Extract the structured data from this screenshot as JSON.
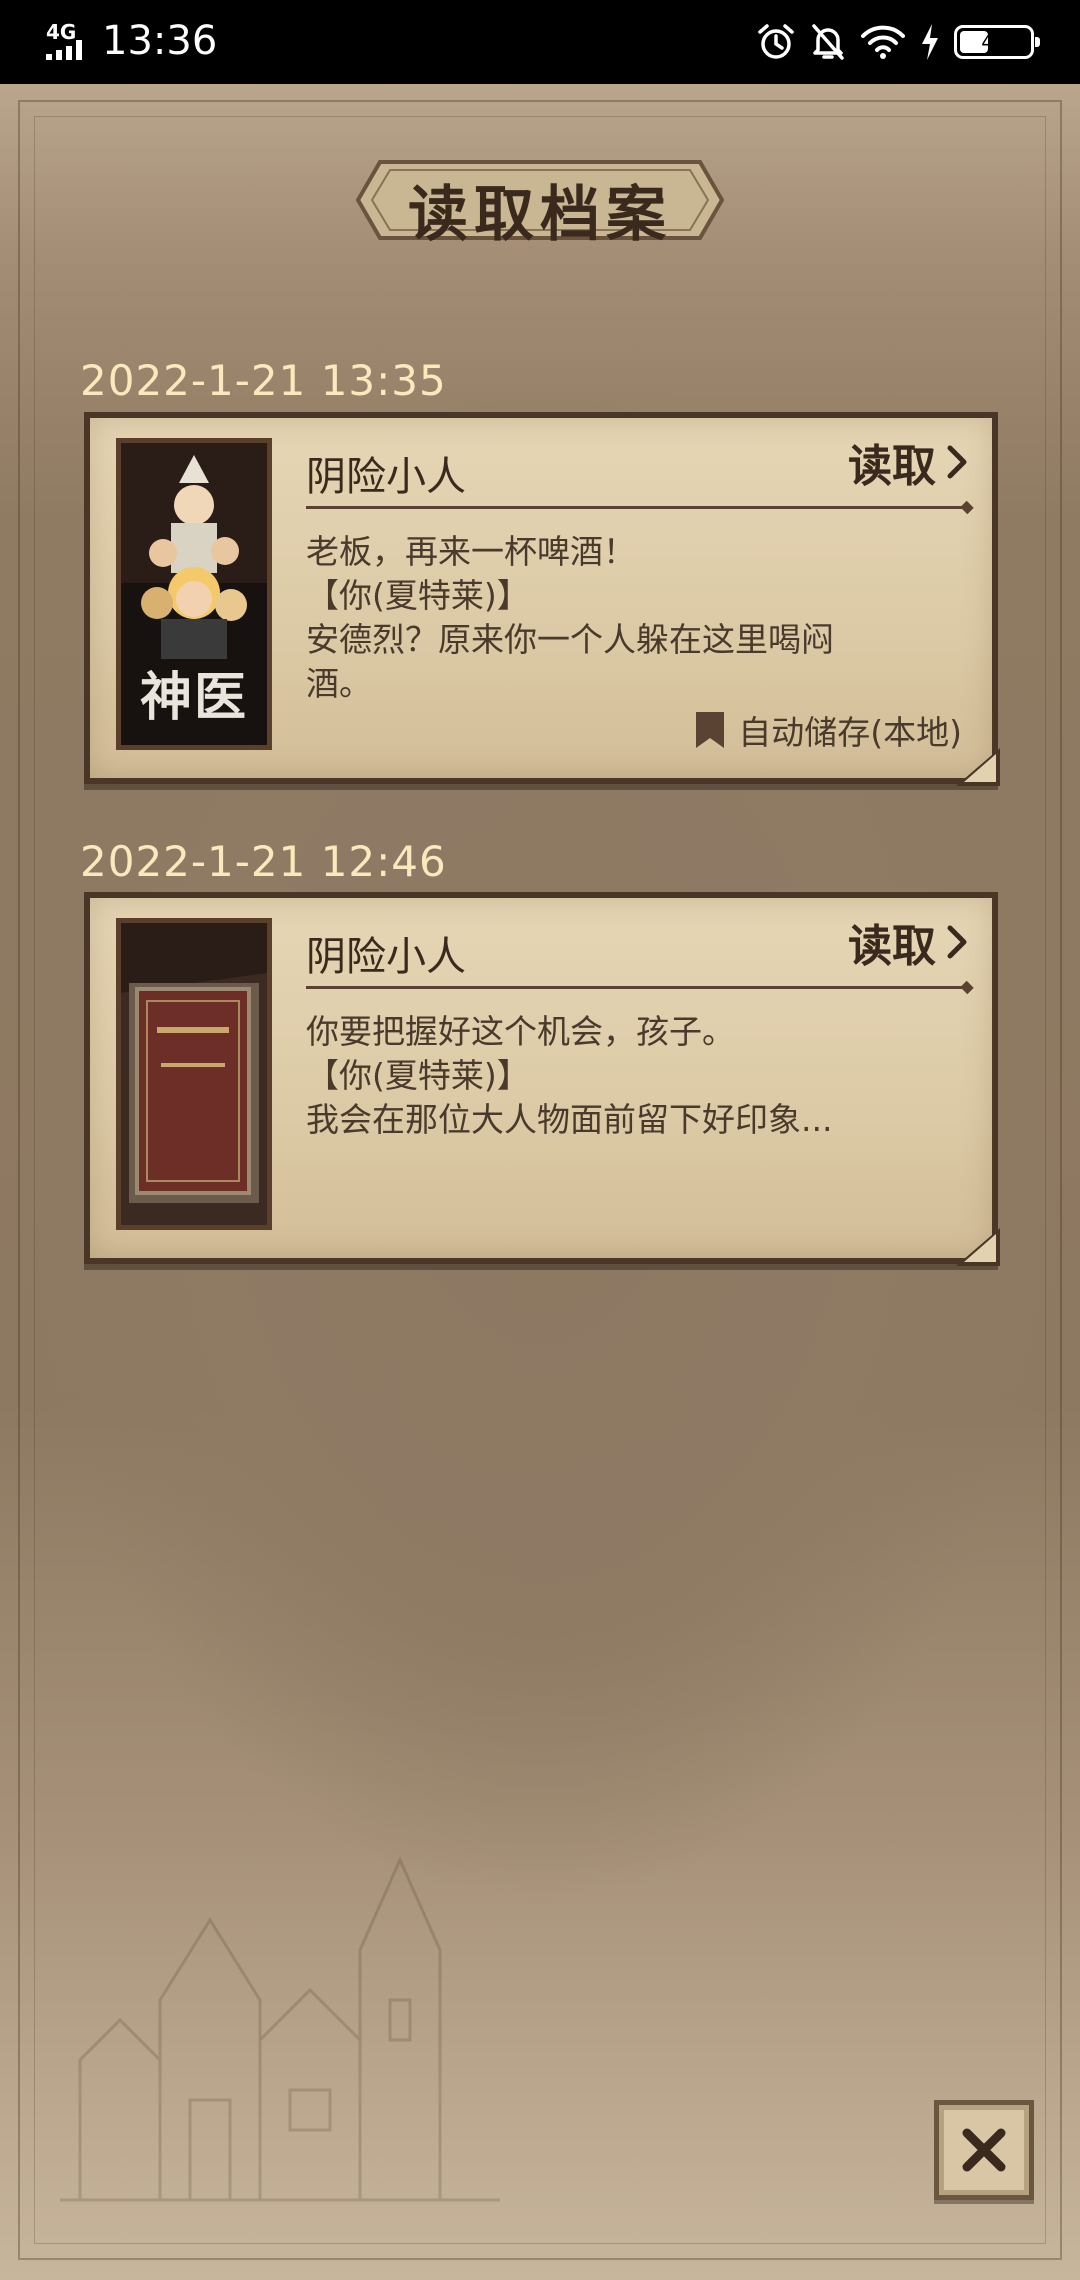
{
  "status_bar": {
    "network": "4G",
    "time": "13:36",
    "battery_level": "46"
  },
  "page": {
    "title": "读取档案"
  },
  "saves": [
    {
      "date": "2022-1-21  13:35",
      "title": "阴险小人",
      "read_label": "读取",
      "lines": [
        "老板，再来一杯啤酒！",
        "【你(夏特莱)】",
        "安德烈？原来你一个人躲在这里喝闷\n酒。"
      ],
      "thumbnail_title": "神医",
      "autosave_label": "自动储存(本地)"
    },
    {
      "date": "2022-1-21  12:46",
      "title": "阴险小人",
      "read_label": "读取",
      "lines": [
        "你要把握好这个机会，孩子。",
        "【你(夏特莱)】",
        "我会在那位大人物面前留下好印象..."
      ]
    }
  ],
  "colors": {
    "parchment": "#dccaa6",
    "ink": "#3a2a1e",
    "date_text": "#fbe9bd",
    "frame": "#4a3627"
  }
}
